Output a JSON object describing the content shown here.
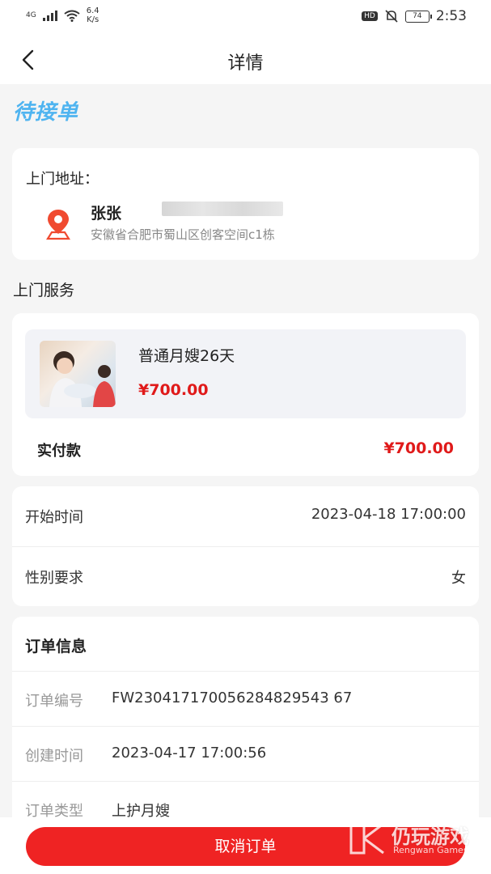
{
  "status_bar": {
    "network": "4G",
    "speed_value": "6.4",
    "speed_unit": "K/s",
    "hd": "HD",
    "battery": "74",
    "time": "2:53"
  },
  "nav": {
    "title": "详情"
  },
  "order_status": "待接单",
  "address": {
    "label": "上门地址：",
    "name": "张张",
    "detail": "安徽省合肥市蜀山区创客空间c1栋"
  },
  "service_section_title": "上门服务",
  "service": {
    "name": "普通月嫂26天",
    "price": "¥700.00",
    "paid_label": "实付款",
    "paid_value": "¥700.00"
  },
  "requirements": [
    {
      "label": "开始时间",
      "value": "2023-04-18 17:00:00"
    },
    {
      "label": "性别要求",
      "value": "女"
    }
  ],
  "order_info": {
    "title": "订单信息",
    "rows": [
      {
        "key": "订单编号",
        "value": "FW230417170056284829543 67"
      },
      {
        "key": "创建时间",
        "value": "2023-04-17 17:00:56"
      },
      {
        "key": "订单类型",
        "value": "上护月嫂"
      }
    ]
  },
  "actions": {
    "cancel_label": "取消订单"
  },
  "watermark": {
    "cn": "仍玩游戏",
    "en": "Rengwan Games"
  },
  "colors": {
    "accent_red": "#ef2323",
    "status_blue": "#4fb4f0",
    "price_red": "#e01a1a"
  }
}
